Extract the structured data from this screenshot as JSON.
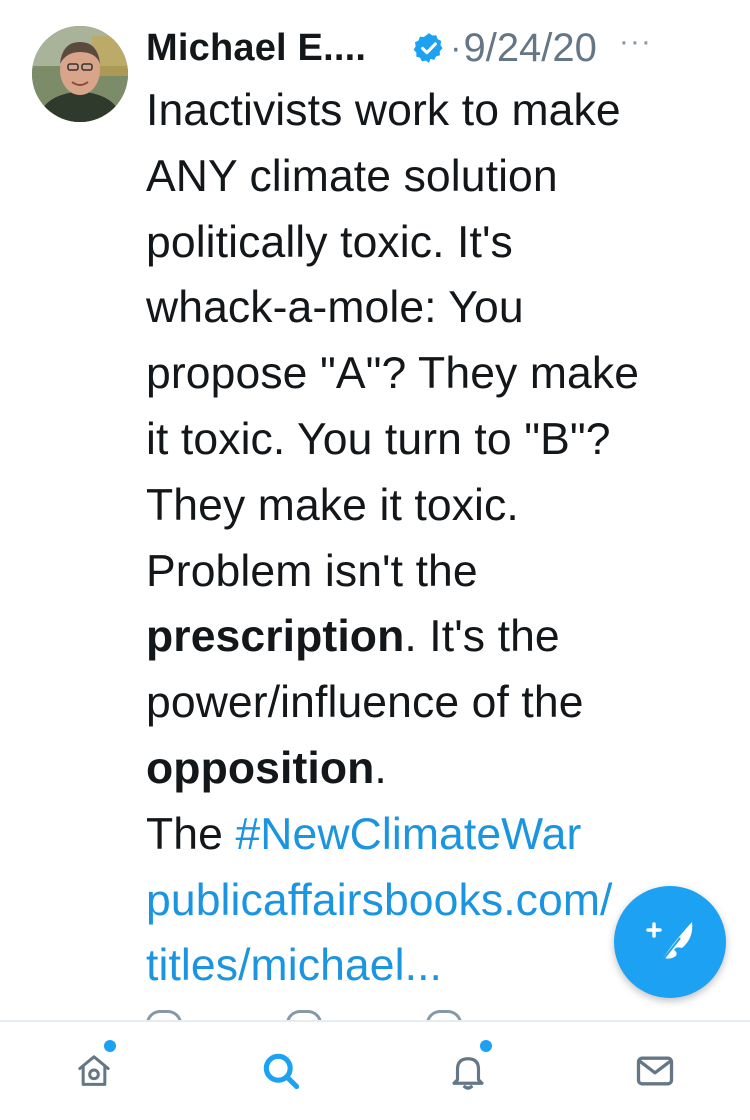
{
  "tweet": {
    "author_name": "Michael E....",
    "verified": true,
    "separator": "·",
    "date": "9/24/20",
    "more_label": "···",
    "body_lines": [
      [
        {
          "t": "Inactivists work to make"
        }
      ],
      [
        {
          "t": "ANY climate solution"
        }
      ],
      [
        {
          "t": "politically toxic. It's"
        }
      ],
      [
        {
          "t": "whack-a-mole: You"
        }
      ],
      [
        {
          "t": "propose \"A\"? They make"
        }
      ],
      [
        {
          "t": "it toxic. You turn to \"B\"?"
        }
      ],
      [
        {
          "t": "They make it toxic."
        }
      ],
      [
        {
          "t": "Problem isn't the"
        }
      ],
      [
        {
          "t": "prescription",
          "style": "bold"
        },
        {
          "t": ". It's the"
        }
      ],
      [
        {
          "t": "power/influence of the"
        }
      ],
      [
        {
          "t": "opposition",
          "style": "bold"
        },
        {
          "t": "."
        }
      ],
      [
        {
          "t": "The "
        },
        {
          "t": "#NewClimateWar",
          "style": "link"
        }
      ],
      [
        {
          "t": "publicaffairsbooks.com/",
          "style": "link"
        }
      ],
      [
        {
          "t": "titles/michael...",
          "style": "link"
        }
      ]
    ]
  },
  "compose_button": {
    "icon": "compose-quill-icon"
  },
  "tabbar": {
    "tabs": [
      {
        "name": "home",
        "icon": "home-icon",
        "active": false,
        "badge": true
      },
      {
        "name": "search",
        "icon": "search-icon",
        "active": true,
        "badge": false
      },
      {
        "name": "notifications",
        "icon": "bell-icon",
        "active": false,
        "badge": true
      },
      {
        "name": "messages",
        "icon": "envelope-icon",
        "active": false,
        "badge": false
      }
    ]
  },
  "colors": {
    "text": "#14171a",
    "muted": "#657786",
    "link": "#1b95e0",
    "accent": "#1da1f2",
    "tab_inactive": "#657786"
  }
}
